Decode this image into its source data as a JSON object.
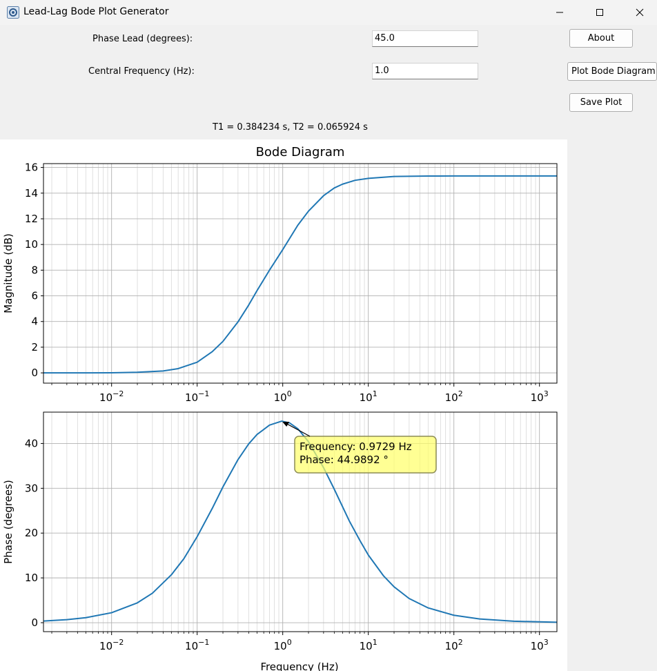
{
  "window": {
    "title": "Lead-Lag Bode Plot Generator",
    "minimize_glyph": "—",
    "maximize_glyph": "☐",
    "close_glyph": "✕"
  },
  "form": {
    "phase_lead_label": "Phase Lead (degrees):",
    "phase_lead_value": "45.0",
    "central_freq_label": "Central Frequency (Hz):",
    "central_freq_value": "1.0",
    "result_text": "T1 = 0.384234 s, T2 = 0.065924 s"
  },
  "buttons": {
    "about": "About",
    "plot": "Plot Bode Diagram",
    "save": "Save Plot"
  },
  "colors": {
    "line": "#1f77b4",
    "annotation_bg": "#ffff66",
    "annotation_border": "#8c8c55"
  },
  "icons": {
    "app": "gear-app-icon"
  },
  "chart_data": [
    {
      "type": "line",
      "title": "Bode Diagram",
      "xlabel": "",
      "ylabel": "Magnitude (dB)",
      "xscale": "log",
      "xlim": [
        0.0016,
        1600
      ],
      "ylim": [
        -0.8,
        16.3
      ],
      "yticks": [
        0,
        2,
        4,
        6,
        8,
        10,
        12,
        14,
        16
      ],
      "xtick_labels": [
        "10^-2",
        "10^-1",
        "10^0",
        "10^1",
        "10^2",
        "10^3"
      ],
      "grid": true,
      "series": [
        {
          "x": [
            0.0016,
            0.004,
            0.01,
            0.02,
            0.04,
            0.06,
            0.1,
            0.15,
            0.2,
            0.3,
            0.4,
            0.5,
            0.7,
            1.0,
            1.5,
            2.0,
            3.0,
            4.0,
            5.0,
            7.0,
            10,
            20,
            50,
            100,
            1000,
            1600
          ],
          "y": [
            0.0,
            0.0,
            0.01,
            0.05,
            0.15,
            0.33,
            0.83,
            1.65,
            2.45,
            3.97,
            5.28,
            6.4,
            8.0,
            9.6,
            11.5,
            12.6,
            13.8,
            14.4,
            14.7,
            15.0,
            15.15,
            15.3,
            15.33,
            15.34,
            15.34,
            15.34
          ]
        }
      ]
    },
    {
      "type": "line",
      "title": "",
      "xlabel": "Frequency (Hz)",
      "ylabel": "Phase (degrees)",
      "xscale": "log",
      "xlim": [
        0.0016,
        1600
      ],
      "ylim": [
        -2,
        47
      ],
      "yticks": [
        0,
        10,
        20,
        30,
        40
      ],
      "xtick_labels": [
        "10^-2",
        "10^-1",
        "10^0",
        "10^1",
        "10^2",
        "10^3"
      ],
      "grid": true,
      "series": [
        {
          "x": [
            0.0016,
            0.003,
            0.005,
            0.01,
            0.02,
            0.03,
            0.05,
            0.07,
            0.1,
            0.15,
            0.2,
            0.3,
            0.4,
            0.5,
            0.7,
            0.9729,
            1.2,
            1.5,
            2.0,
            3.0,
            4.0,
            6.0,
            8.0,
            10,
            15,
            20,
            30,
            50,
            100,
            200,
            500,
            1600
          ],
          "y": [
            0.36,
            0.67,
            1.12,
            2.23,
            4.43,
            6.58,
            10.7,
            14.3,
            19.2,
            25.5,
            30.3,
            36.4,
            39.9,
            42.0,
            44.1,
            44.99,
            44.6,
            43.3,
            40.4,
            34.6,
            29.8,
            22.7,
            18.3,
            15.1,
            10.5,
            8.0,
            5.4,
            3.3,
            1.66,
            0.83,
            0.33,
            0.1
          ]
        }
      ],
      "annotation": {
        "line1": "Frequency: 0.9729 Hz",
        "line2": "Phase: 44.9892 °",
        "x": 0.9729,
        "y": 44.9892
      }
    }
  ]
}
